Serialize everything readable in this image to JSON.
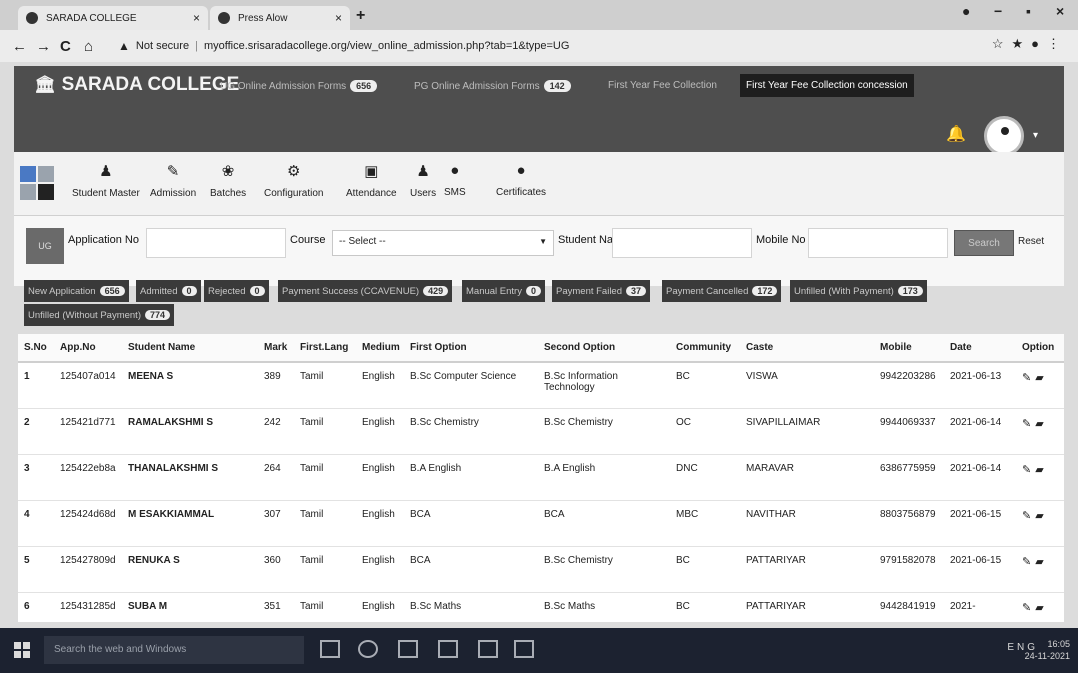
{
  "browser": {
    "tabs": [
      {
        "label": "SARADA COLLEGE"
      },
      {
        "label": "Press Alow"
      }
    ],
    "security_label": "Not secure",
    "url": "myoffice.srisaradacollege.org/view_online_admission.php?tab=1&type=UG"
  },
  "header": {
    "brand": "SARADA COLLEGE",
    "nav": [
      {
        "label": "UG Online Admission Forms",
        "count": "656"
      },
      {
        "label": "PG Online Admission Forms",
        "count": "142"
      },
      {
        "label": "First Year Fee Collection"
      },
      {
        "label": "First Year Fee Collection concession"
      }
    ]
  },
  "toolbar": {
    "items": [
      {
        "label": "Student Master",
        "icon": "user-plus-icon"
      },
      {
        "label": "Admission",
        "icon": "edit-icon"
      },
      {
        "label": "Batches",
        "icon": "users-icon"
      },
      {
        "label": "Configuration",
        "icon": "cogs-icon"
      },
      {
        "label": "Attendance",
        "icon": "clipboard-icon"
      },
      {
        "label": "Users",
        "icon": "user-icon"
      },
      {
        "label": "SMS",
        "icon": "chat-icon"
      },
      {
        "label": "Certificates",
        "icon": "circle-icon"
      }
    ]
  },
  "filters": {
    "ug_label": "UG",
    "application_no_label": "Application No",
    "course_label": "Course",
    "course_selected": "-- Select --",
    "student_name_label": "Student Name",
    "mobile_no_label": "Mobile No",
    "search_label": "Search",
    "reset_label": "Reset"
  },
  "status_tabs": [
    {
      "label": "New Application",
      "count": "656"
    },
    {
      "label": "Admitted",
      "count": "0"
    },
    {
      "label": "Rejected",
      "count": "0"
    },
    {
      "label": "Payment Success (CCAVENUE)",
      "count": "429"
    },
    {
      "label": "Manual Entry",
      "count": "0"
    },
    {
      "label": "Payment Failed",
      "count": "37"
    },
    {
      "label": "Payment Cancelled",
      "count": "172"
    },
    {
      "label": "Unfilled (With Payment)",
      "count": "173"
    },
    {
      "label": "Unfilled (Without Payment)",
      "count": "774"
    }
  ],
  "table": {
    "columns": [
      "S.No",
      "App.No",
      "Student Name",
      "Mark",
      "First.Lang",
      "Medium",
      "First Option",
      "Second Option",
      "Community",
      "Caste",
      "Mobile",
      "Date",
      "Option"
    ],
    "rows": [
      {
        "sno": "1",
        "app_no": "125407a014",
        "name": "MEENA S",
        "mark": "389",
        "lang": "Tamil",
        "medium": "English",
        "first": "B.Sc Computer Science",
        "second": "B.Sc Information Technology",
        "community": "BC",
        "caste": "VISWA",
        "mobile": "9942203286",
        "date": "2021-06-13"
      },
      {
        "sno": "2",
        "app_no": "125421d771",
        "name": "RAMALAKSHMI S",
        "mark": "242",
        "lang": "Tamil",
        "medium": "English",
        "first": "B.Sc Chemistry",
        "second": "B.Sc Chemistry",
        "community": "OC",
        "caste": "SIVAPILLAIMAR",
        "mobile": "9944069337",
        "date": "2021-06-14"
      },
      {
        "sno": "3",
        "app_no": "125422eb8a",
        "name": "THANALAKSHMI S",
        "mark": "264",
        "lang": "Tamil",
        "medium": "English",
        "first": "B.A English",
        "second": "B.A English",
        "community": "DNC",
        "caste": "MARAVAR",
        "mobile": "6386775959",
        "date": "2021-06-14"
      },
      {
        "sno": "4",
        "app_no": "125424d68d",
        "name": "M ESAKKIAMMAL",
        "mark": "307",
        "lang": "Tamil",
        "medium": "English",
        "first": "BCA",
        "second": "BCA",
        "community": "MBC",
        "caste": "NAVITHAR",
        "mobile": "8803756879",
        "date": "2021-06-15"
      },
      {
        "sno": "5",
        "app_no": "125427809d",
        "name": "RENUKA S",
        "mark": "360",
        "lang": "Tamil",
        "medium": "English",
        "first": "BCA",
        "second": "B.Sc Chemistry",
        "community": "BC",
        "caste": "PATTARIYAR",
        "mobile": "9791582078",
        "date": "2021-06-15"
      },
      {
        "sno": "6",
        "app_no": "125431285d",
        "name": "SUBA M",
        "mark": "351",
        "lang": "Tamil",
        "medium": "English",
        "first": "B.Sc Maths",
        "second": "B.Sc Maths",
        "community": "BC",
        "caste": "PATTARIYAR",
        "mobile": "9442841919",
        "date": "2021-"
      }
    ]
  },
  "taskbar": {
    "search_placeholder": "Search the web and Windows",
    "tray_text": "ENG",
    "time": "16:05",
    "date": "24-11-2021"
  }
}
